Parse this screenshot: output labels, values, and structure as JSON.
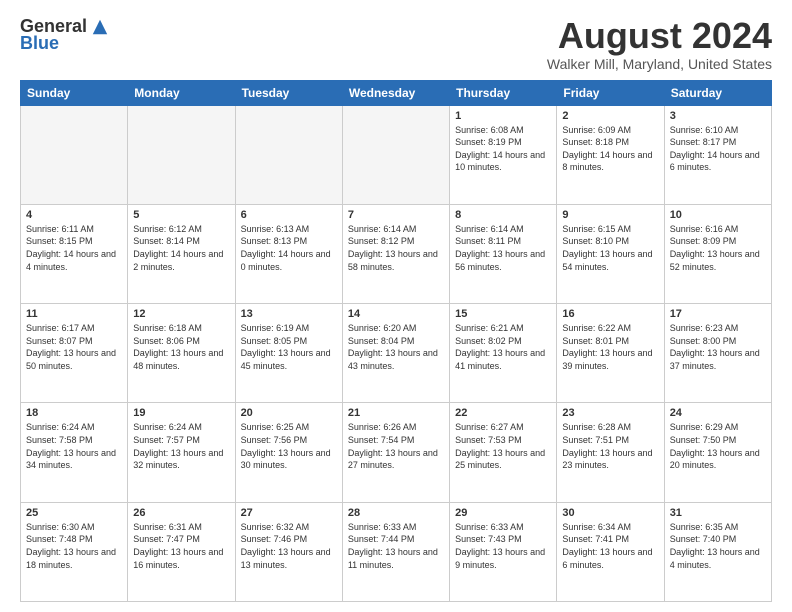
{
  "logo": {
    "general": "General",
    "blue": "Blue"
  },
  "title": "August 2024",
  "location": "Walker Mill, Maryland, United States",
  "days_of_week": [
    "Sunday",
    "Monday",
    "Tuesday",
    "Wednesday",
    "Thursday",
    "Friday",
    "Saturday"
  ],
  "weeks": [
    [
      {
        "day": "",
        "empty": true
      },
      {
        "day": "",
        "empty": true
      },
      {
        "day": "",
        "empty": true
      },
      {
        "day": "",
        "empty": true
      },
      {
        "day": "1",
        "sunrise": "6:08 AM",
        "sunset": "8:19 PM",
        "daylight": "14 hours and 10 minutes."
      },
      {
        "day": "2",
        "sunrise": "6:09 AM",
        "sunset": "8:18 PM",
        "daylight": "14 hours and 8 minutes."
      },
      {
        "day": "3",
        "sunrise": "6:10 AM",
        "sunset": "8:17 PM",
        "daylight": "14 hours and 6 minutes."
      }
    ],
    [
      {
        "day": "4",
        "sunrise": "6:11 AM",
        "sunset": "8:15 PM",
        "daylight": "14 hours and 4 minutes."
      },
      {
        "day": "5",
        "sunrise": "6:12 AM",
        "sunset": "8:14 PM",
        "daylight": "14 hours and 2 minutes."
      },
      {
        "day": "6",
        "sunrise": "6:13 AM",
        "sunset": "8:13 PM",
        "daylight": "14 hours and 0 minutes."
      },
      {
        "day": "7",
        "sunrise": "6:14 AM",
        "sunset": "8:12 PM",
        "daylight": "13 hours and 58 minutes."
      },
      {
        "day": "8",
        "sunrise": "6:14 AM",
        "sunset": "8:11 PM",
        "daylight": "13 hours and 56 minutes."
      },
      {
        "day": "9",
        "sunrise": "6:15 AM",
        "sunset": "8:10 PM",
        "daylight": "13 hours and 54 minutes."
      },
      {
        "day": "10",
        "sunrise": "6:16 AM",
        "sunset": "8:09 PM",
        "daylight": "13 hours and 52 minutes."
      }
    ],
    [
      {
        "day": "11",
        "sunrise": "6:17 AM",
        "sunset": "8:07 PM",
        "daylight": "13 hours and 50 minutes."
      },
      {
        "day": "12",
        "sunrise": "6:18 AM",
        "sunset": "8:06 PM",
        "daylight": "13 hours and 48 minutes."
      },
      {
        "day": "13",
        "sunrise": "6:19 AM",
        "sunset": "8:05 PM",
        "daylight": "13 hours and 45 minutes."
      },
      {
        "day": "14",
        "sunrise": "6:20 AM",
        "sunset": "8:04 PM",
        "daylight": "13 hours and 43 minutes."
      },
      {
        "day": "15",
        "sunrise": "6:21 AM",
        "sunset": "8:02 PM",
        "daylight": "13 hours and 41 minutes."
      },
      {
        "day": "16",
        "sunrise": "6:22 AM",
        "sunset": "8:01 PM",
        "daylight": "13 hours and 39 minutes."
      },
      {
        "day": "17",
        "sunrise": "6:23 AM",
        "sunset": "8:00 PM",
        "daylight": "13 hours and 37 minutes."
      }
    ],
    [
      {
        "day": "18",
        "sunrise": "6:24 AM",
        "sunset": "7:58 PM",
        "daylight": "13 hours and 34 minutes."
      },
      {
        "day": "19",
        "sunrise": "6:24 AM",
        "sunset": "7:57 PM",
        "daylight": "13 hours and 32 minutes."
      },
      {
        "day": "20",
        "sunrise": "6:25 AM",
        "sunset": "7:56 PM",
        "daylight": "13 hours and 30 minutes."
      },
      {
        "day": "21",
        "sunrise": "6:26 AM",
        "sunset": "7:54 PM",
        "daylight": "13 hours and 27 minutes."
      },
      {
        "day": "22",
        "sunrise": "6:27 AM",
        "sunset": "7:53 PM",
        "daylight": "13 hours and 25 minutes."
      },
      {
        "day": "23",
        "sunrise": "6:28 AM",
        "sunset": "7:51 PM",
        "daylight": "13 hours and 23 minutes."
      },
      {
        "day": "24",
        "sunrise": "6:29 AM",
        "sunset": "7:50 PM",
        "daylight": "13 hours and 20 minutes."
      }
    ],
    [
      {
        "day": "25",
        "sunrise": "6:30 AM",
        "sunset": "7:48 PM",
        "daylight": "13 hours and 18 minutes."
      },
      {
        "day": "26",
        "sunrise": "6:31 AM",
        "sunset": "7:47 PM",
        "daylight": "13 hours and 16 minutes."
      },
      {
        "day": "27",
        "sunrise": "6:32 AM",
        "sunset": "7:46 PM",
        "daylight": "13 hours and 13 minutes."
      },
      {
        "day": "28",
        "sunrise": "6:33 AM",
        "sunset": "7:44 PM",
        "daylight": "13 hours and 11 minutes."
      },
      {
        "day": "29",
        "sunrise": "6:33 AM",
        "sunset": "7:43 PM",
        "daylight": "13 hours and 9 minutes."
      },
      {
        "day": "30",
        "sunrise": "6:34 AM",
        "sunset": "7:41 PM",
        "daylight": "13 hours and 6 minutes."
      },
      {
        "day": "31",
        "sunrise": "6:35 AM",
        "sunset": "7:40 PM",
        "daylight": "13 hours and 4 minutes."
      }
    ]
  ]
}
